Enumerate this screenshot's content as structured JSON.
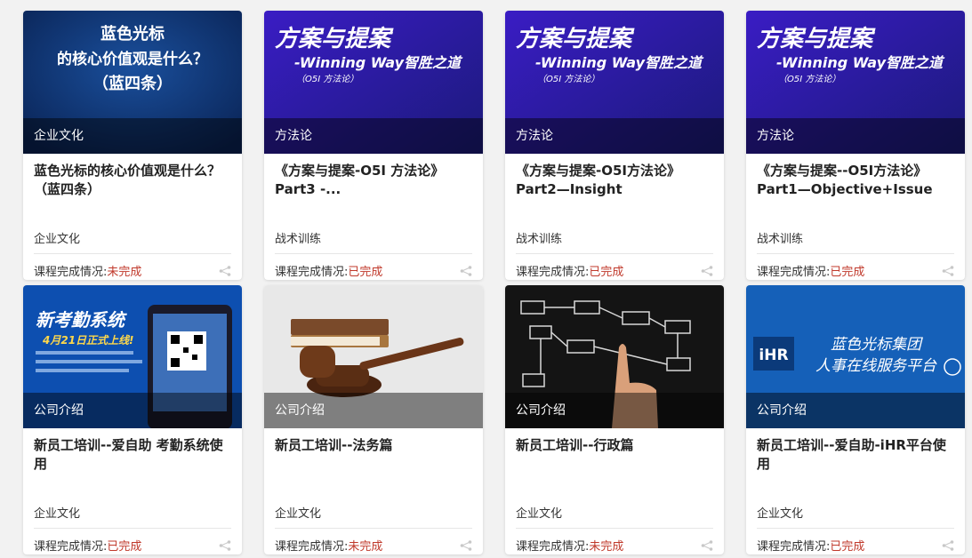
{
  "status_prefix": "课程完成情况:",
  "cards": [
    {
      "thumb_lines": [
        "蓝色光标",
        "的核心价值观是什么？",
        "（蓝四条）"
      ],
      "category": "企业文化",
      "title": "蓝色光标的核心价值观是什么？（蓝四条）",
      "tag": "企业文化",
      "status": "未完成",
      "icon": "share-icon"
    },
    {
      "thumb_lines": [
        "方案与提案",
        "-Winning Way智胜之道",
        "（O5I 方法论）"
      ],
      "category": "方法论",
      "title": "《方案与提案-O5I 方法论》 Part3 -...",
      "tag": "战术训练",
      "status": "已完成",
      "icon": "share-icon"
    },
    {
      "thumb_lines": [
        "方案与提案",
        "-Winning Way智胜之道",
        "（O5I 方法论）"
      ],
      "category": "方法论",
      "title": "《方案与提案-O5I方法论》 Part2—Insight",
      "tag": "战术训练",
      "status": "已完成",
      "icon": "share-icon"
    },
    {
      "thumb_lines": [
        "方案与提案",
        "-Winning Way智胜之道",
        "（O5I 方法论）"
      ],
      "category": "方法论",
      "title": "《方案与提案--O5I方法论》 Part1—Objective+Issue",
      "tag": "战术训练",
      "status": "已完成",
      "icon": "share-icon"
    },
    {
      "thumb_lines": [
        "新考勤系统",
        "4月21日正式上线!"
      ],
      "category": "公司介绍",
      "title": "新员工培训--爱自助 考勤系统使用",
      "tag": "企业文化",
      "status": "已完成",
      "icon": "share-icon"
    },
    {
      "thumb_lines": [],
      "category": "公司介绍",
      "title": "新员工培训--法务篇",
      "tag": "企业文化",
      "status": "未完成",
      "icon": "share-icon"
    },
    {
      "thumb_lines": [],
      "category": "公司介绍",
      "title": "新员工培训--行政篇",
      "tag": "企业文化",
      "status": "未完成",
      "icon": "share-icon"
    },
    {
      "thumb_lines": [
        "iHR",
        "蓝色光标集团",
        "人事在线服务平台"
      ],
      "category": "公司介绍",
      "title": "新员工培训--爱自助-iHR平台使用",
      "tag": "企业文化",
      "status": "已完成",
      "icon": "share-icon"
    }
  ]
}
